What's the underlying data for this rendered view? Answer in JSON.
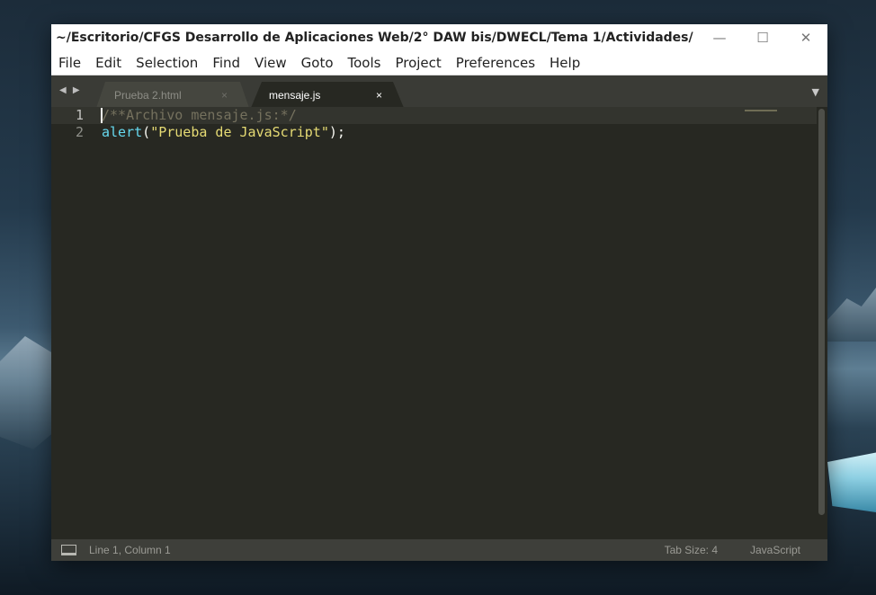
{
  "window": {
    "title": "~/Escritorio/CFGS Desarrollo de Aplicaciones Web/2° DAW bis/DWECL/Tema 1/Actividades/",
    "controls": {
      "minimize": "—",
      "maximize": "☐",
      "close": "✕"
    }
  },
  "menu": [
    "File",
    "Edit",
    "Selection",
    "Find",
    "View",
    "Goto",
    "Tools",
    "Project",
    "Preferences",
    "Help"
  ],
  "tabs": {
    "nav_arrows": "◀ ▶",
    "items": [
      {
        "label": "Prueba 2.html",
        "close": "×",
        "active": false
      },
      {
        "label": "mensaje.js",
        "close": "×",
        "active": true
      }
    ],
    "dropdown": "▼"
  },
  "editor": {
    "line_numbers": [
      "1",
      "2"
    ],
    "line1": {
      "comment": "/**Archivo mensaje.js:*/"
    },
    "line2": {
      "func": "alert",
      "open": "(",
      "string": "\"Prueba de JavaScript\"",
      "close": ");"
    }
  },
  "status": {
    "position": "Line 1, Column 1",
    "tab_size": "Tab Size: 4",
    "syntax": "JavaScript"
  },
  "colors": {
    "editor_bg": "#272822",
    "comment": "#75715e",
    "function": "#66d9ef",
    "string": "#e6db74",
    "text": "#f8f8f2"
  }
}
